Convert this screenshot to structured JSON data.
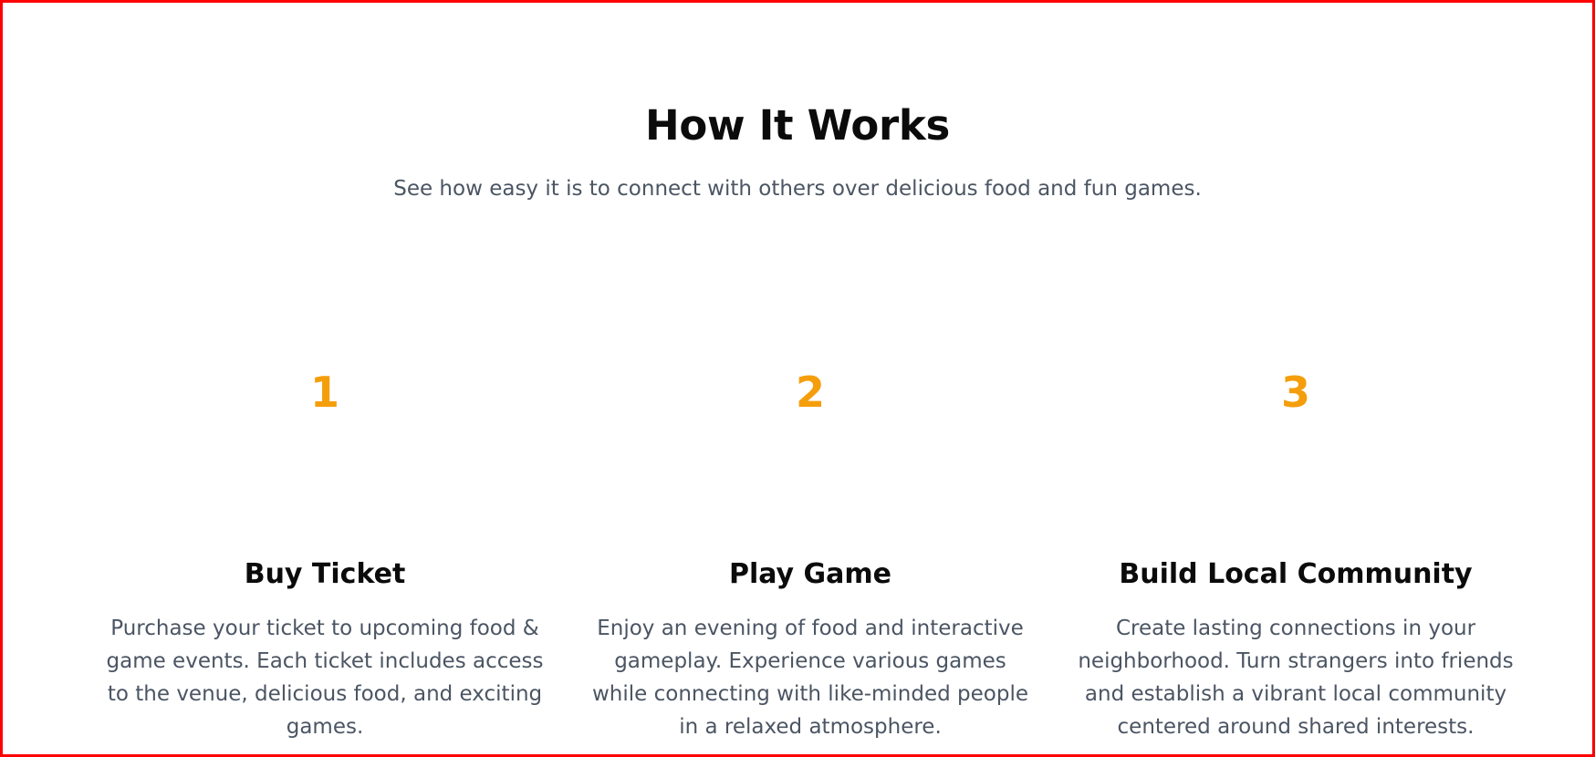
{
  "section": {
    "title": "How It Works",
    "subtitle": "See how easy it is to connect with others over delicious food and fun games."
  },
  "steps": [
    {
      "number": "1",
      "title": "Buy Ticket",
      "description": "Purchase your ticket to upcoming food & game events. Each ticket includes access to the venue, delicious food, and exciting games."
    },
    {
      "number": "2",
      "title": "Play Game",
      "description": "Enjoy an evening of food and interactive gameplay. Experience various games while connecting with like-minded people in a relaxed atmosphere."
    },
    {
      "number": "3",
      "title": "Build Local Community",
      "description": "Create lasting connections in your neighborhood. Turn strangers into friends and establish a vibrant local community centered around shared interests."
    }
  ],
  "colors": {
    "accent": "#f59e0b",
    "heading": "#0b0b0b",
    "body_text": "#4b5563",
    "frame_border": "#ff0000"
  }
}
